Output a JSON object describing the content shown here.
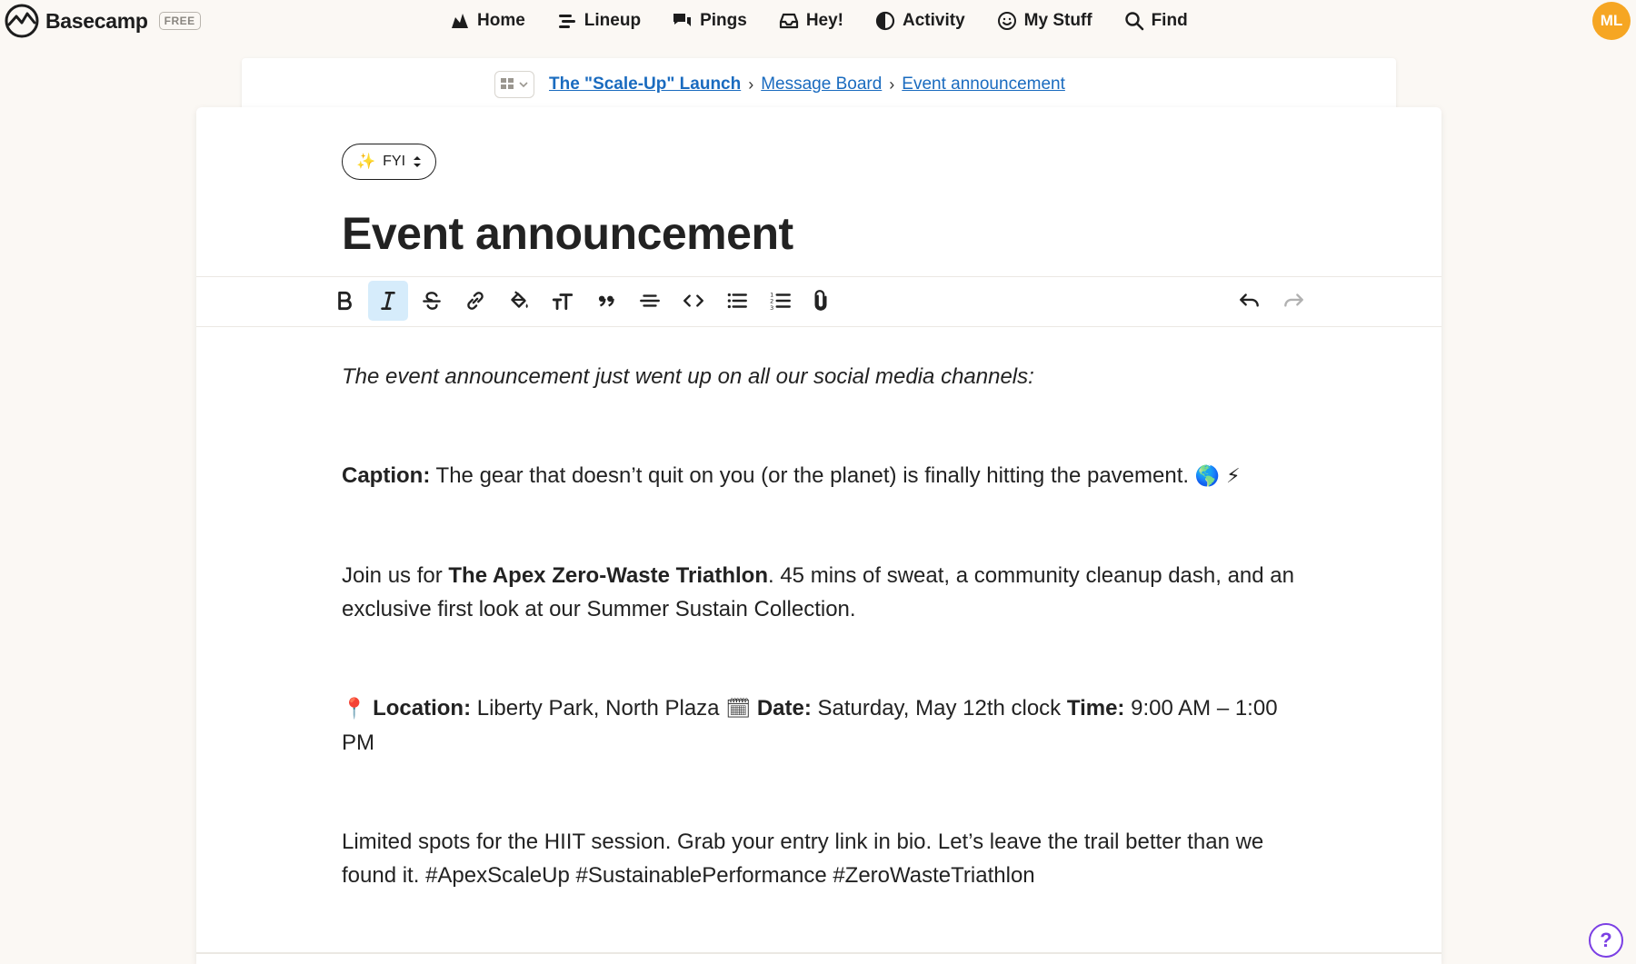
{
  "app": {
    "brand": "Basecamp",
    "plan_badge": "FREE",
    "avatar_initials": "ML",
    "avatar_color": "#f6a623"
  },
  "nav": {
    "items": [
      {
        "label": "Home",
        "icon": "home-icon"
      },
      {
        "label": "Lineup",
        "icon": "lineup-icon"
      },
      {
        "label": "Pings",
        "icon": "pings-icon"
      },
      {
        "label": "Hey!",
        "icon": "inbox-icon"
      },
      {
        "label": "Activity",
        "icon": "activity-icon"
      },
      {
        "label": "My Stuff",
        "icon": "smiley-icon"
      },
      {
        "label": "Find",
        "icon": "search-icon"
      }
    ]
  },
  "breadcrumb": {
    "project": "The \"Scale-Up\" Launch",
    "tool": "Message Board",
    "current": "Event announcement",
    "separator": "›"
  },
  "message": {
    "category": "FYI",
    "category_icon": "✨",
    "title": "Event announcement"
  },
  "toolbar": {
    "buttons": [
      "bold",
      "italic",
      "strikethrough",
      "link",
      "highlight",
      "heading",
      "quote",
      "divider",
      "code",
      "bullet-list",
      "numbered-list",
      "attach"
    ],
    "active": "italic",
    "undo": "undo",
    "redo": "redo"
  },
  "body": {
    "intro": "The event announcement just went up on all our social media channels:",
    "caption_label": "Caption:",
    "caption_text": " The gear that doesn’t quit on you (or the planet) is finally hitting the pavement. ",
    "caption_emoji": "🌎 ⚡",
    "join_prefix": "Join us for ",
    "join_event": "The Apex Zero-Waste Triathlon",
    "join_rest": ". 45 mins of sweat, a community cleanup dash, and an exclusive first look at our Summer Sustain Collection.",
    "pin_emoji": "📍",
    "location_label": "Location:",
    "location_value": " Liberty Park, North Plaza ",
    "calendar_emoji": "🗓",
    "date_label": "Date:",
    "date_value": " Saturday, May 12th clock ",
    "time_label": "Time:",
    "time_value": " 9:00 AM – 1:00 PM",
    "closing": "Limited spots for the HIIT session. Grab your entry link in bio. Let’s leave the trail better than we found it. #ApexScaleUp #SustainablePerformance #ZeroWasteTriathlon"
  },
  "help": {
    "label": "?"
  }
}
